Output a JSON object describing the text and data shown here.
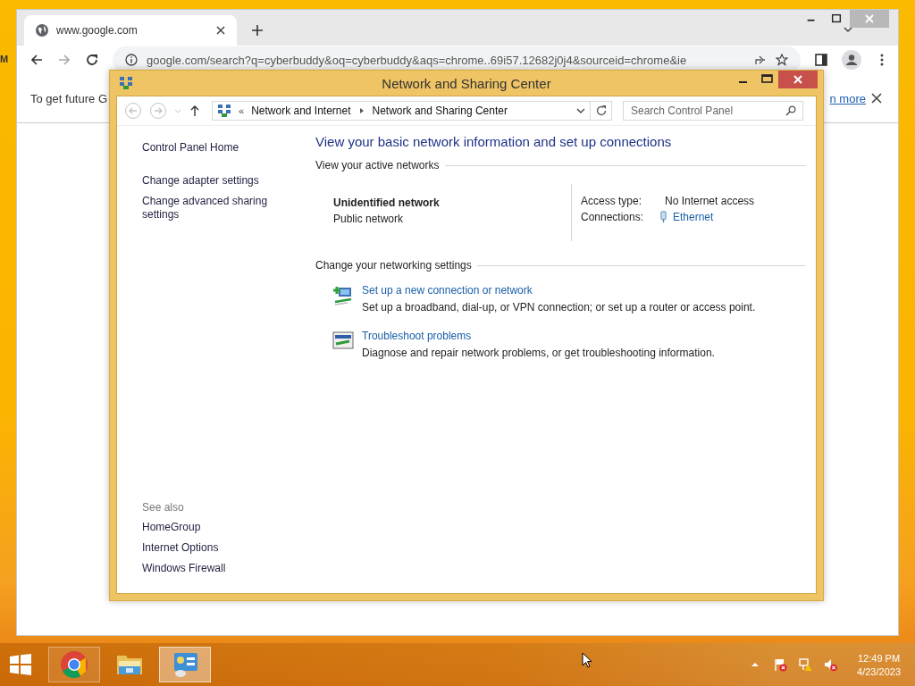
{
  "desktop": {
    "icon_label": "M"
  },
  "browser": {
    "tab": {
      "title": "www.google.com",
      "selected": true
    },
    "url": "google.com/search?q=cyberbuddy&oq=cyberbuddy&aqs=chrome..69i57.12682j0j4&sourceid=chrome&ie",
    "notice": {
      "text": "To get future G",
      "link": "n more"
    }
  },
  "control_panel": {
    "title": "Network and Sharing Center",
    "breadcrumb_prefix": "«",
    "breadcrumb": [
      "Network and Internet",
      "Network and Sharing Center"
    ],
    "search": {
      "placeholder": "Search Control Panel"
    },
    "sidebar": {
      "items": [
        "Control Panel Home",
        "Change adapter settings",
        "Change advanced sharing settings"
      ],
      "see_also_heading": "See also",
      "see_also": [
        "HomeGroup",
        "Internet Options",
        "Windows Firewall"
      ]
    },
    "main": {
      "heading": "View your basic network information and set up connections",
      "active_heading": "View your active networks",
      "network": {
        "name": "Unidentified network",
        "type": "Public network",
        "access_label": "Access type:",
        "access": "No Internet access",
        "connections_label": "Connections:",
        "connection": "Ethernet"
      },
      "settings_heading": "Change your networking settings",
      "tasks": [
        {
          "kind": "setup",
          "link": "Set up a new connection or network",
          "description": "Set up a broadband, dial-up, or VPN connection; or set up a router or access point."
        },
        {
          "kind": "troubleshoot",
          "link": "Troubleshoot problems",
          "description": "Diagnose and repair network problems, or get troubleshooting information."
        }
      ]
    }
  },
  "taskbar": {
    "apps": [
      {
        "kind": "chrome",
        "running": true,
        "selected": false
      },
      {
        "kind": "explorer",
        "running": false,
        "selected": false
      },
      {
        "kind": "control-panel",
        "running": true,
        "selected": true
      }
    ],
    "time": "12:49 PM",
    "date": "4/23/2023"
  }
}
